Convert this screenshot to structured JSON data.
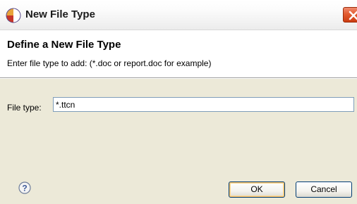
{
  "window": {
    "title": "New File Type"
  },
  "banner": {
    "title": "Define a New File Type",
    "description": "Enter file type to add: (*.doc or report.doc for example)"
  },
  "form": {
    "file_type_label": "File type:",
    "file_type_value": "*.ttcn"
  },
  "buttons": {
    "ok_label": "OK",
    "cancel_label": "Cancel"
  },
  "icons": {
    "app": "eclipse-icon",
    "close": "close-icon",
    "help": "help-icon"
  },
  "colors": {
    "close_button": "#e25a2e",
    "body_background": "#ece9d8",
    "ok_focus_ring": "#f5c26b"
  }
}
